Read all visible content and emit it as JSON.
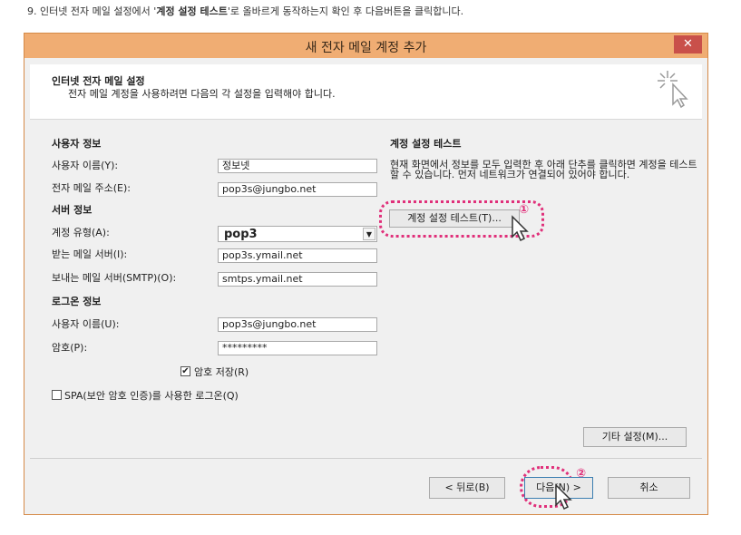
{
  "instruction": {
    "prefix": "9. 인터넷 전자 메일 설정에서 '",
    "bold": "계정 설정 테스트",
    "suffix": "'로 올바르게 동작하는지 확인 후 다음버튼을 클릭합니다."
  },
  "dialog": {
    "title": "새 전자 메일 계정 추가",
    "close_label": "✕",
    "header": {
      "title": "인터넷 전자 메일 설정",
      "description": "전자 메일 계정을 사용하려면 다음의 각 설정을 입력해야 합니다."
    },
    "user_info": {
      "section_title": "사용자 정보",
      "name_label": "사용자 이름(Y):",
      "name_value": "정보넷",
      "email_label": "전자 메일 주소(E):",
      "email_value": "pop3s@jungbo.net"
    },
    "server_info": {
      "section_title": "서버 정보",
      "account_type_label": "계정 유형(A):",
      "account_type_value": "pop3",
      "incoming_label": "받는 메일 서버(I):",
      "incoming_value": "pop3s.ymail.net",
      "outgoing_label": "보내는 메일 서버(SMTP)(O):",
      "outgoing_value": "smtps.ymail.net"
    },
    "logon_info": {
      "section_title": "로그온 정보",
      "username_label": "사용자 이름(U):",
      "username_value": "pop3s@jungbo.net",
      "password_label": "암호(P):",
      "password_value": "*********",
      "save_password_label": "암호 저장(R)",
      "save_password_checked": true,
      "spa_label": "SPA(보안 암호 인증)를 사용한 로그온(Q)",
      "spa_checked": false
    },
    "test": {
      "section_title": "계정 설정 테스트",
      "description": "현재 화면에서 정보를 모두 입력한 후 아래 단추를 클릭하면 계정을 테스트할 수 있습니다. 먼저 네트워크가 연결되어 있어야 합니다.",
      "button_label": "계정 설정 테스트(T)..."
    },
    "more_settings_label": "기타 설정(M)...",
    "footer": {
      "back_label": "< 뒤로(B)",
      "next_label": "다음(N) >",
      "cancel_label": "취소"
    },
    "annotations": {
      "marker_1": "①",
      "marker_2": "②"
    }
  },
  "colors": {
    "titlebar": "#f0ad73",
    "close": "#c9504a",
    "highlight": "#e0307a"
  }
}
